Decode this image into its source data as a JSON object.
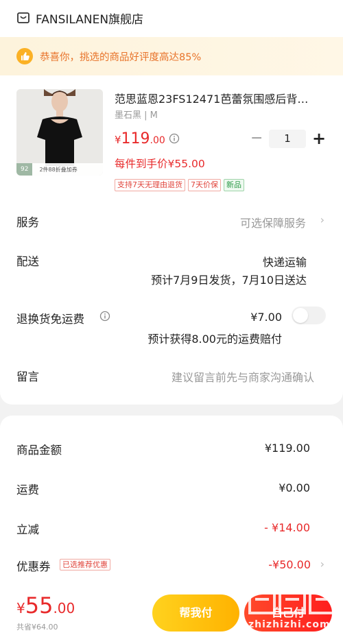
{
  "header": {
    "store_name": "FANSILANEN旗舰店"
  },
  "banner": {
    "text": "恭喜你，挑选的商品好评度高达85%"
  },
  "product": {
    "badge_score": "92",
    "badge_text": "2件88折叠加券",
    "title": "范思蓝恩23FS12471芭蕾氛围感后背…",
    "variant": "墨石黑 | M",
    "price_currency": "¥",
    "price_int": "119",
    "price_dec": ".00",
    "quantity": "1",
    "minus_label": "−",
    "plus_label": "+",
    "unit_price": "每件到手价¥55.00",
    "tags": [
      "支持7天无理由退货",
      "7天价保",
      "新品"
    ]
  },
  "service": {
    "label": "服务",
    "value": "可选保障服务",
    "chevron": "›"
  },
  "delivery": {
    "label": "配送",
    "method": "快递运输",
    "eta": "预计7月9日发货，7月10日送达"
  },
  "return_insurance": {
    "label": "退换货免运费",
    "price": "¥7.00",
    "note": "预计获得8.00元的运费赔付",
    "enabled": false
  },
  "message": {
    "label": "留言",
    "placeholder": "建议留言前先与商家沟通确认"
  },
  "summary": {
    "goods_label": "商品金额",
    "goods_value": "¥119.00",
    "shipping_label": "运费",
    "shipping_value": "¥0.00",
    "discount_label": "立减",
    "discount_value": "- ¥14.00",
    "coupon_label": "优惠券",
    "coupon_tag": "已选推荐优惠",
    "coupon_value": "-¥50.00",
    "coupon_chevron": "›"
  },
  "footer": {
    "total_currency": "¥",
    "total_int": "55",
    "total_dec": ".00",
    "saved": "共省¥64.00",
    "help_button": "帮我付",
    "pay_button": "自己付"
  },
  "watermark": {
    "text": "zhizhizhi.com"
  },
  "colors": {
    "accent_red": "#e8292a",
    "accent_yellow": "#ffb200",
    "banner_orange": "#e8732a"
  },
  "icons": [
    "store-icon",
    "thumbs-up-icon",
    "info-icon",
    "chevron-right-icon"
  ]
}
